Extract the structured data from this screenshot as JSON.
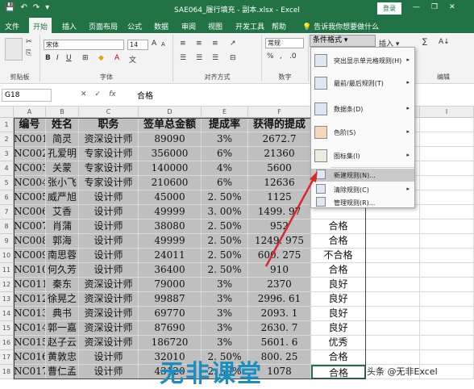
{
  "window": {
    "title": "SAE064_履行填充 - 副本.xlsx - Excel",
    "login": "登录",
    "qat": [
      "💾",
      "↶",
      "↷",
      "▾"
    ],
    "controls": [
      "—",
      "❐",
      "✕"
    ]
  },
  "tabs": [
    "文件",
    "开始",
    "插入",
    "页面布局",
    "公式",
    "数据",
    "审阅",
    "视图",
    "开发工具",
    "帮助",
    "💡 告诉我你想要做什么"
  ],
  "ribbon": {
    "font_name": "宋体",
    "font_size": "14",
    "number_format": "常规",
    "groups": [
      "剪贴板",
      "字体",
      "对齐方式",
      "数字",
      "编辑"
    ],
    "cond_format": "条件格式 ▾",
    "insert": "插入 ▾",
    "bold": "B",
    "italic": "I",
    "underline": "U",
    "font_grow": "A",
    "font_shrink": "A",
    "percent": "%",
    "sigma": "∑",
    "sort": "A↓"
  },
  "formula": {
    "name_box": "G18",
    "fx": "fx",
    "value": "合格"
  },
  "columns": [
    "A",
    "B",
    "C",
    "D",
    "E",
    "F",
    "G",
    "H",
    "I"
  ],
  "headers": [
    "编号",
    "姓名",
    "职务",
    "签单总金额",
    "提成率",
    "获得的提成",
    ""
  ],
  "rows": [
    [
      "NC001",
      "简灵",
      "资深设计师",
      "89090",
      "3%",
      "2672.7",
      ""
    ],
    [
      "NC002",
      "孔爱明",
      "专家设计师",
      "356000",
      "6%",
      "21360",
      ""
    ],
    [
      "NC003",
      "关蒙",
      "专家设计师",
      "140000",
      "4%",
      "5600",
      ""
    ],
    [
      "NC004",
      "张小飞",
      "专家设计师",
      "210600",
      "6%",
      "12636",
      ""
    ],
    [
      "NC005",
      "威严旭",
      "设计师",
      "45000",
      "2. 50%",
      "1125",
      ""
    ],
    [
      "NC006",
      "艾香",
      "设计师",
      "49999",
      "3. 00%",
      "1499. 97",
      ""
    ],
    [
      "NC007",
      "肖蒲",
      "设计师",
      "38080",
      "2. 50%",
      "952",
      "合格"
    ],
    [
      "NC008",
      "郭海",
      "设计师",
      "49999",
      "2. 50%",
      "1249. 975",
      "合格"
    ],
    [
      "NC009",
      "南思蓉",
      "设计师",
      "24011",
      "2. 50%",
      "600. 275",
      "不合格"
    ],
    [
      "NC010",
      "何久芳",
      "设计师",
      "36400",
      "2. 50%",
      "910",
      "合格"
    ],
    [
      "NC011",
      "秦东",
      "资深设计师",
      "79000",
      "3%",
      "2370",
      "良好"
    ],
    [
      "NC012",
      "徐晃之",
      "资深设计师",
      "99887",
      "3%",
      "2996. 61",
      "良好"
    ],
    [
      "NC013",
      "典书",
      "资深设计师",
      "69770",
      "3%",
      "2093. 1",
      "良好"
    ],
    [
      "NC014",
      "郭一嘉",
      "资深设计师",
      "87690",
      "3%",
      "2630. 7",
      "良好"
    ],
    [
      "NC015",
      "赵子云",
      "资深设计师",
      "186720",
      "3%",
      "5601. 6",
      "优秀"
    ],
    [
      "NC016",
      "黄敦忠",
      "设计师",
      "32010",
      "2. 50%",
      "800. 25",
      "合格"
    ],
    [
      "NC017",
      "曹仁孟",
      "设计师",
      "43120",
      "2. 50%",
      "1078",
      "合格"
    ]
  ],
  "menu": {
    "items": [
      {
        "label": "突出显示单元格规则(H)",
        "arrow": "▸"
      },
      {
        "label": "最前/最后规则(T)",
        "arrow": "▸"
      },
      {
        "label": "数据条(D)",
        "arrow": "▸"
      },
      {
        "label": "色阶(S)",
        "arrow": "▸"
      },
      {
        "label": "图标集(I)",
        "arrow": "▸"
      },
      {
        "label": "新建规则(N)...",
        "arrow": ""
      },
      {
        "label": "清除规则(C)",
        "arrow": "▸"
      },
      {
        "label": "管理规则(R)...",
        "arrow": ""
      }
    ]
  },
  "watermark": "无非课堂",
  "credit": "头条 @无非Excel"
}
